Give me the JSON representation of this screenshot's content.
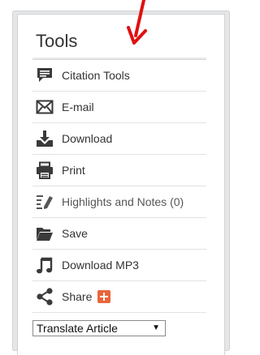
{
  "panel": {
    "title": "Tools"
  },
  "tools": {
    "items": [
      {
        "label": "Citation Tools",
        "icon": "speech-bubble-icon"
      },
      {
        "label": "E-mail",
        "icon": "envelope-icon"
      },
      {
        "label": "Download",
        "icon": "download-icon"
      },
      {
        "label": "Print",
        "icon": "printer-icon"
      },
      {
        "label": "Highlights and Notes (0)",
        "icon": "highlighter-icon"
      },
      {
        "label": "Save",
        "icon": "folder-icon"
      },
      {
        "label": "Download MP3",
        "icon": "music-note-icon"
      },
      {
        "label": "Share",
        "icon": "share-icon"
      }
    ]
  },
  "translate": {
    "selected": "Translate Article",
    "arrow": "▼"
  },
  "colors": {
    "icon": "#3a3a3a",
    "share_plus": "#e8663a",
    "annotation_arrow": "#e01010"
  }
}
